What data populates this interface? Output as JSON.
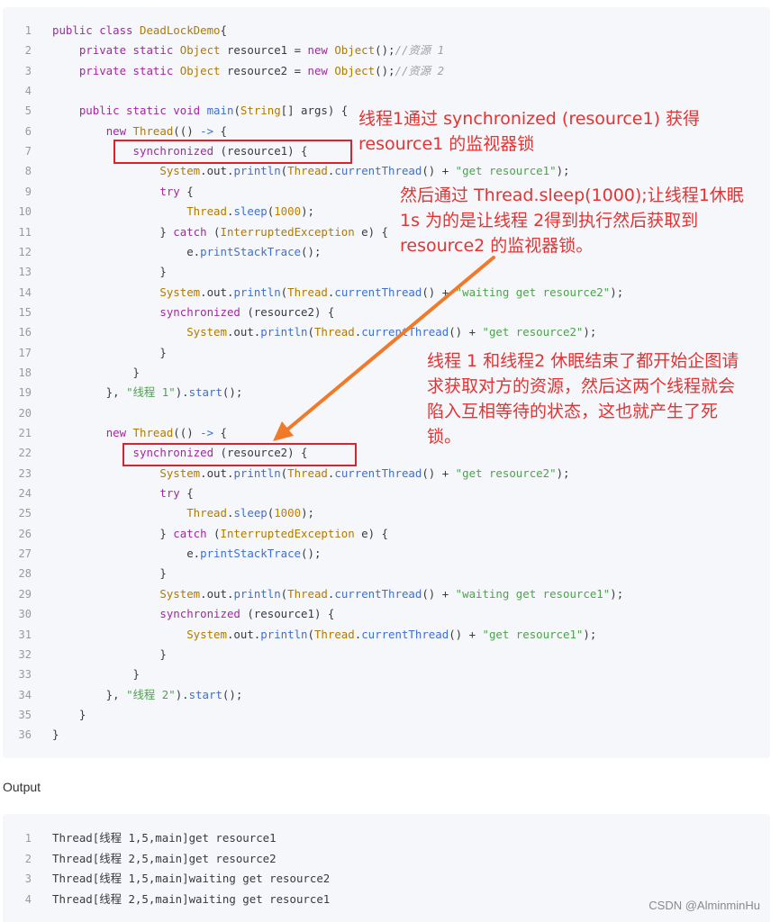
{
  "code": {
    "lines": [
      {
        "n": "1",
        "tokens": [
          [
            "kw",
            "public class "
          ],
          [
            "ty",
            "DeadLockDemo"
          ],
          [
            "",
            "{"
          ]
        ]
      },
      {
        "n": "2",
        "tokens": [
          [
            "",
            "    "
          ],
          [
            "kw",
            "private static "
          ],
          [
            "ty",
            "Object"
          ],
          [
            "",
            " resource1 = "
          ],
          [
            "kw",
            "new "
          ],
          [
            "ty",
            "Object"
          ],
          [
            "",
            "();"
          ],
          [
            "cm",
            "//资源 1"
          ]
        ]
      },
      {
        "n": "3",
        "tokens": [
          [
            "",
            "    "
          ],
          [
            "kw",
            "private static "
          ],
          [
            "ty",
            "Object"
          ],
          [
            "",
            " resource2 = "
          ],
          [
            "kw",
            "new "
          ],
          [
            "ty",
            "Object"
          ],
          [
            "",
            "();"
          ],
          [
            "cm",
            "//资源 2"
          ]
        ]
      },
      {
        "n": "4",
        "tokens": []
      },
      {
        "n": "5",
        "tokens": [
          [
            "",
            "    "
          ],
          [
            "kw",
            "public static void "
          ],
          [
            "fn",
            "main"
          ],
          [
            "",
            "("
          ],
          [
            "ty",
            "String"
          ],
          [
            "",
            "[] args) {"
          ]
        ]
      },
      {
        "n": "6",
        "tokens": [
          [
            "",
            "        "
          ],
          [
            "kw",
            "new "
          ],
          [
            "ty",
            "Thread"
          ],
          [
            "",
            "(() "
          ],
          [
            "op",
            "->"
          ],
          [
            "",
            " {"
          ]
        ]
      },
      {
        "n": "7",
        "tokens": [
          [
            "",
            "            "
          ],
          [
            "kw",
            "synchronized"
          ],
          [
            "",
            " (resource1) {"
          ]
        ]
      },
      {
        "n": "8",
        "tokens": [
          [
            "",
            "                "
          ],
          [
            "ty",
            "System"
          ],
          [
            "",
            ".out."
          ],
          [
            "fn",
            "println"
          ],
          [
            "",
            "("
          ],
          [
            "ty",
            "Thread"
          ],
          [
            "",
            "."
          ],
          [
            "fn",
            "currentThread"
          ],
          [
            "",
            "() + "
          ],
          [
            "st",
            "\"get resource1\""
          ],
          [
            "",
            ");"
          ]
        ]
      },
      {
        "n": "9",
        "tokens": [
          [
            "",
            "                "
          ],
          [
            "kw",
            "try"
          ],
          [
            "",
            " {"
          ]
        ]
      },
      {
        "n": "10",
        "tokens": [
          [
            "",
            "                    "
          ],
          [
            "ty",
            "Thread"
          ],
          [
            "",
            "."
          ],
          [
            "fn",
            "sleep"
          ],
          [
            "",
            "("
          ],
          [
            "nu",
            "1000"
          ],
          [
            "",
            ");"
          ]
        ]
      },
      {
        "n": "11",
        "tokens": [
          [
            "",
            "                } "
          ],
          [
            "kw",
            "catch"
          ],
          [
            "",
            " ("
          ],
          [
            "ty",
            "InterruptedException"
          ],
          [
            "",
            " e) {"
          ]
        ]
      },
      {
        "n": "12",
        "tokens": [
          [
            "",
            "                    e."
          ],
          [
            "fn",
            "printStackTrace"
          ],
          [
            "",
            "();"
          ]
        ]
      },
      {
        "n": "13",
        "tokens": [
          [
            "",
            "                }"
          ]
        ]
      },
      {
        "n": "14",
        "tokens": [
          [
            "",
            "                "
          ],
          [
            "ty",
            "System"
          ],
          [
            "",
            ".out."
          ],
          [
            "fn",
            "println"
          ],
          [
            "",
            "("
          ],
          [
            "ty",
            "Thread"
          ],
          [
            "",
            "."
          ],
          [
            "fn",
            "currentThread"
          ],
          [
            "",
            "() + "
          ],
          [
            "st",
            "\"waiting get resource2\""
          ],
          [
            "",
            ");"
          ]
        ]
      },
      {
        "n": "15",
        "tokens": [
          [
            "",
            "                "
          ],
          [
            "kw",
            "synchronized"
          ],
          [
            "",
            " (resource2) {"
          ]
        ]
      },
      {
        "n": "16",
        "tokens": [
          [
            "",
            "                    "
          ],
          [
            "ty",
            "System"
          ],
          [
            "",
            ".out."
          ],
          [
            "fn",
            "println"
          ],
          [
            "",
            "("
          ],
          [
            "ty",
            "Thread"
          ],
          [
            "",
            "."
          ],
          [
            "fn",
            "currentThread"
          ],
          [
            "",
            "() + "
          ],
          [
            "st",
            "\"get resource2\""
          ],
          [
            "",
            ");"
          ]
        ]
      },
      {
        "n": "17",
        "tokens": [
          [
            "",
            "                }"
          ]
        ]
      },
      {
        "n": "18",
        "tokens": [
          [
            "",
            "            }"
          ]
        ]
      },
      {
        "n": "19",
        "tokens": [
          [
            "",
            "        }, "
          ],
          [
            "st",
            "\"线程 1\""
          ],
          [
            "",
            ")."
          ],
          [
            "fn",
            "start"
          ],
          [
            "",
            "();"
          ]
        ]
      },
      {
        "n": "20",
        "tokens": []
      },
      {
        "n": "21",
        "tokens": [
          [
            "",
            "        "
          ],
          [
            "kw",
            "new "
          ],
          [
            "ty",
            "Thread"
          ],
          [
            "",
            "(() "
          ],
          [
            "op",
            "->"
          ],
          [
            "",
            " {"
          ]
        ]
      },
      {
        "n": "22",
        "tokens": [
          [
            "",
            "            "
          ],
          [
            "kw",
            "synchronized"
          ],
          [
            "",
            " (resource2) {"
          ]
        ]
      },
      {
        "n": "23",
        "tokens": [
          [
            "",
            "                "
          ],
          [
            "ty",
            "System"
          ],
          [
            "",
            ".out."
          ],
          [
            "fn",
            "println"
          ],
          [
            "",
            "("
          ],
          [
            "ty",
            "Thread"
          ],
          [
            "",
            "."
          ],
          [
            "fn",
            "currentThread"
          ],
          [
            "",
            "() + "
          ],
          [
            "st",
            "\"get resource2\""
          ],
          [
            "",
            ");"
          ]
        ]
      },
      {
        "n": "24",
        "tokens": [
          [
            "",
            "                "
          ],
          [
            "kw",
            "try"
          ],
          [
            "",
            " {"
          ]
        ]
      },
      {
        "n": "25",
        "tokens": [
          [
            "",
            "                    "
          ],
          [
            "ty",
            "Thread"
          ],
          [
            "",
            "."
          ],
          [
            "fn",
            "sleep"
          ],
          [
            "",
            "("
          ],
          [
            "nu",
            "1000"
          ],
          [
            "",
            ");"
          ]
        ]
      },
      {
        "n": "26",
        "tokens": [
          [
            "",
            "                } "
          ],
          [
            "kw",
            "catch"
          ],
          [
            "",
            " ("
          ],
          [
            "ty",
            "InterruptedException"
          ],
          [
            "",
            " e) {"
          ]
        ]
      },
      {
        "n": "27",
        "tokens": [
          [
            "",
            "                    e."
          ],
          [
            "fn",
            "printStackTrace"
          ],
          [
            "",
            "();"
          ]
        ]
      },
      {
        "n": "28",
        "tokens": [
          [
            "",
            "                }"
          ]
        ]
      },
      {
        "n": "29",
        "tokens": [
          [
            "",
            "                "
          ],
          [
            "ty",
            "System"
          ],
          [
            "",
            ".out."
          ],
          [
            "fn",
            "println"
          ],
          [
            "",
            "("
          ],
          [
            "ty",
            "Thread"
          ],
          [
            "",
            "."
          ],
          [
            "fn",
            "currentThread"
          ],
          [
            "",
            "() + "
          ],
          [
            "st",
            "\"waiting get resource1\""
          ],
          [
            "",
            ");"
          ]
        ]
      },
      {
        "n": "30",
        "tokens": [
          [
            "",
            "                "
          ],
          [
            "kw",
            "synchronized"
          ],
          [
            "",
            " (resource1) {"
          ]
        ]
      },
      {
        "n": "31",
        "tokens": [
          [
            "",
            "                    "
          ],
          [
            "ty",
            "System"
          ],
          [
            "",
            ".out."
          ],
          [
            "fn",
            "println"
          ],
          [
            "",
            "("
          ],
          [
            "ty",
            "Thread"
          ],
          [
            "",
            "."
          ],
          [
            "fn",
            "currentThread"
          ],
          [
            "",
            "() + "
          ],
          [
            "st",
            "\"get resource1\""
          ],
          [
            "",
            ");"
          ]
        ]
      },
      {
        "n": "32",
        "tokens": [
          [
            "",
            "                }"
          ]
        ]
      },
      {
        "n": "33",
        "tokens": [
          [
            "",
            "            }"
          ]
        ]
      },
      {
        "n": "34",
        "tokens": [
          [
            "",
            "        }, "
          ],
          [
            "st",
            "\"线程 2\""
          ],
          [
            "",
            ")."
          ],
          [
            "fn",
            "start"
          ],
          [
            "",
            "();"
          ]
        ]
      },
      {
        "n": "35",
        "tokens": [
          [
            "",
            "    }"
          ]
        ]
      },
      {
        "n": "36",
        "tokens": [
          [
            "",
            "}"
          ]
        ]
      }
    ]
  },
  "annotations": {
    "note1": [
      "线程1通过 synchronized (resource1) 获得",
      "resource1 的监视器锁"
    ],
    "note2": [
      "然后通过 Thread.sleep(1000);让线程1休眠",
      "1s 为的是让线程 2得到执行然后获取到",
      "resource2 的监视器锁。"
    ],
    "note3": [
      "线程 1 和线程2 休眠结束了都开始企图请",
      "求获取对方的资源，然后这两个线程就会",
      "陷入互相等待的状态，这也就产生了死",
      "锁。"
    ]
  },
  "output": {
    "label": "Output",
    "lines": [
      {
        "n": "1",
        "text": "Thread[线程 1,5,main]get resource1"
      },
      {
        "n": "2",
        "text": "Thread[线程 2,5,main]get resource2"
      },
      {
        "n": "3",
        "text": "Thread[线程 1,5,main]waiting get resource2"
      },
      {
        "n": "4",
        "text": "Thread[线程 2,5,main]waiting get resource1"
      }
    ]
  },
  "watermark": "CSDN @AlminminHu",
  "colors": {
    "annotation": "#e53333",
    "arrow": "#f07a2a",
    "box": "#e0202a",
    "code_bg": "#f5f7fa"
  }
}
